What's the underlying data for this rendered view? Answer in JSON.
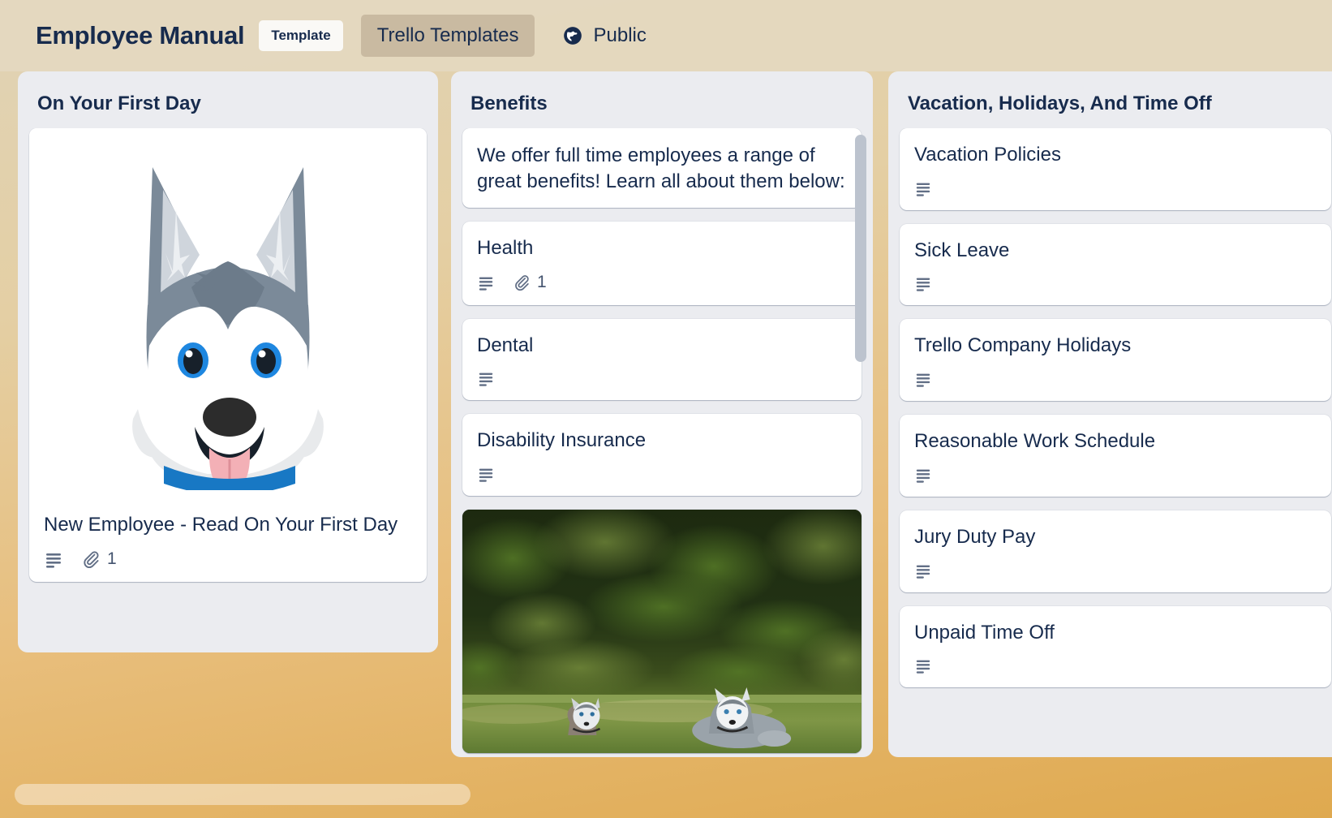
{
  "header": {
    "board_title": "Employee Manual",
    "template_badge": "Template",
    "workspace_name": "Trello Templates",
    "visibility": "Public",
    "globe_icon": "globe-icon"
  },
  "lists": [
    {
      "title": "On Your First Day",
      "cards": [
        {
          "cover": "husky-avatar-illustration",
          "title": "New Employee - Read On Your First Day",
          "has_description": true,
          "attachment_count": "1"
        }
      ]
    },
    {
      "title": "Benefits",
      "cards": [
        {
          "text": "We offer full time employees a range of great benefits! Learn all about them below:",
          "has_description": false
        },
        {
          "title": "Health",
          "has_description": true,
          "attachment_count": "1"
        },
        {
          "title": "Dental",
          "has_description": true
        },
        {
          "title": "Disability Insurance",
          "has_description": true
        },
        {
          "cover": "two-huskies-on-grass-photo"
        }
      ]
    },
    {
      "title": "Vacation, Holidays, And Time Off",
      "cards": [
        {
          "title": "Vacation Policies",
          "has_description": true
        },
        {
          "title": "Sick Leave",
          "has_description": true
        },
        {
          "title": "Trello Company Holidays",
          "has_description": true
        },
        {
          "title": "Reasonable Work Schedule",
          "has_description": true
        },
        {
          "title": "Jury Duty Pay",
          "has_description": true
        },
        {
          "title": "Unpaid Time Off",
          "has_description": true
        }
      ]
    }
  ],
  "colors": {
    "board_background": "#e8be7c",
    "list_background": "#ebecf0",
    "card_background": "#ffffff",
    "text_primary": "#172b4d",
    "text_muted": "#44546f",
    "scrollbar_thumb": "#bcc3ce",
    "template_badge_bg": "#faf9f6"
  }
}
